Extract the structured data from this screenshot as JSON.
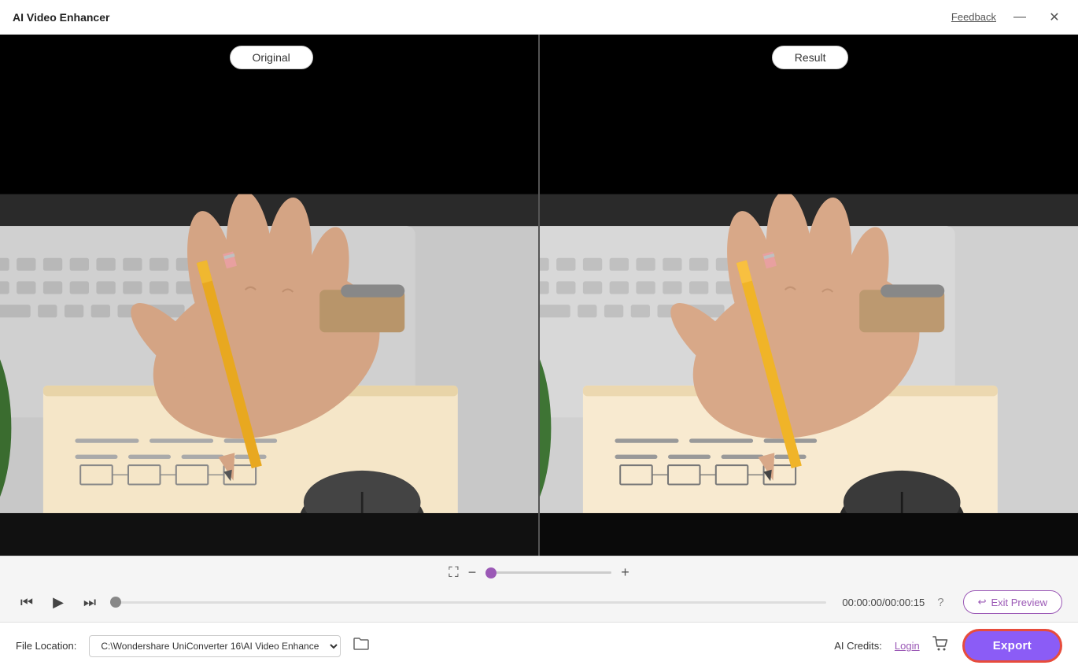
{
  "titleBar": {
    "appTitle": "AI Video Enhancer",
    "feedback": "Feedback",
    "minimizeLabel": "—",
    "closeLabel": "✕"
  },
  "preview": {
    "originalLabel": "Original",
    "resultLabel": "Result"
  },
  "zoom": {
    "fitIcon": "⛶",
    "zoomOutIcon": "−",
    "zoomInIcon": "+",
    "sliderValue": 0
  },
  "playback": {
    "stepBackIcon": "⏮",
    "playIcon": "▶",
    "stepForwardIcon": "⏭",
    "currentTime": "00:00:00",
    "totalTime": "00:00:15",
    "timeSeparator": "/",
    "exitPreviewLabel": "Exit Preview"
  },
  "bottomBar": {
    "fileLocationLabel": "File Location:",
    "filePath": "C:\\Wondershare UniConverter 16\\AI Video Enhance",
    "aiCreditsLabel": "AI Credits:",
    "loginLabel": "Login",
    "exportLabel": "Export"
  }
}
